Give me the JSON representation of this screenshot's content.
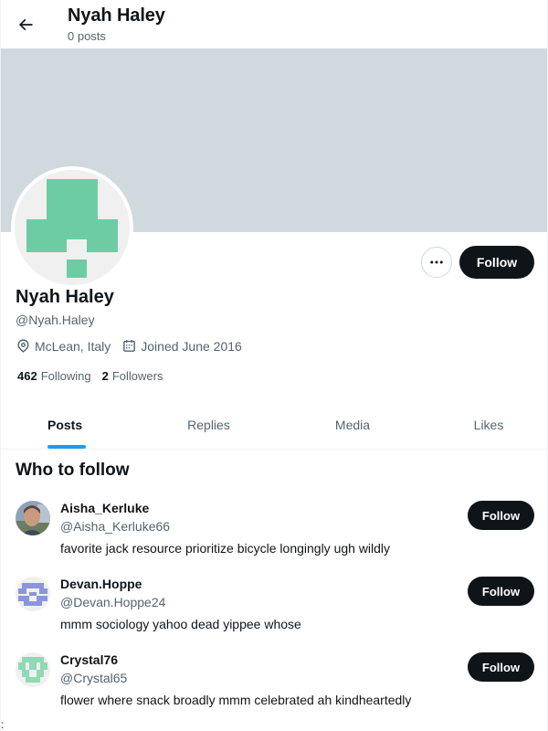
{
  "header": {
    "title": "Nyah Haley",
    "posts_count": "0 posts"
  },
  "profile": {
    "name": "Nyah Haley",
    "handle": "@Nyah.Haley",
    "location": "McLean, Italy",
    "joined": "Joined June 2016",
    "following_count": "462",
    "following_label": "Following",
    "followers_count": "2",
    "followers_label": "Followers",
    "follow_label": "Follow",
    "banner_color": "#cfd9de",
    "avatar_color": "#6dcca4"
  },
  "tabs": [
    {
      "label": "Posts",
      "active": true
    },
    {
      "label": "Replies",
      "active": false
    },
    {
      "label": "Media",
      "active": false
    },
    {
      "label": "Likes",
      "active": false
    }
  ],
  "who_to_follow": {
    "title": "Who to follow",
    "suggestions": [
      {
        "name": "Aisha_Kerluke",
        "handle": "@Aisha_Kerluke66",
        "bio": "favorite jack resource prioritize bicycle longingly ugh wildly",
        "follow_label": "Follow",
        "avatar": "photo"
      },
      {
        "name": "Devan.Hoppe",
        "handle": "@Devan.Hoppe24",
        "bio": "mmm sociology yahoo dead yippee whose",
        "follow_label": "Follow",
        "avatar": "identicon-blue"
      },
      {
        "name": "Crystal76",
        "handle": "@Crystal65",
        "bio": "flower where snack broadly mmm celebrated ah kindheartedly",
        "follow_label": "Follow",
        "avatar": "identicon-green"
      }
    ]
  },
  "colors": {
    "accent": "#1d9bf0",
    "button": "#0f1419",
    "muted_text": "#536471"
  },
  "footer": {
    "edge_mark": ":"
  }
}
